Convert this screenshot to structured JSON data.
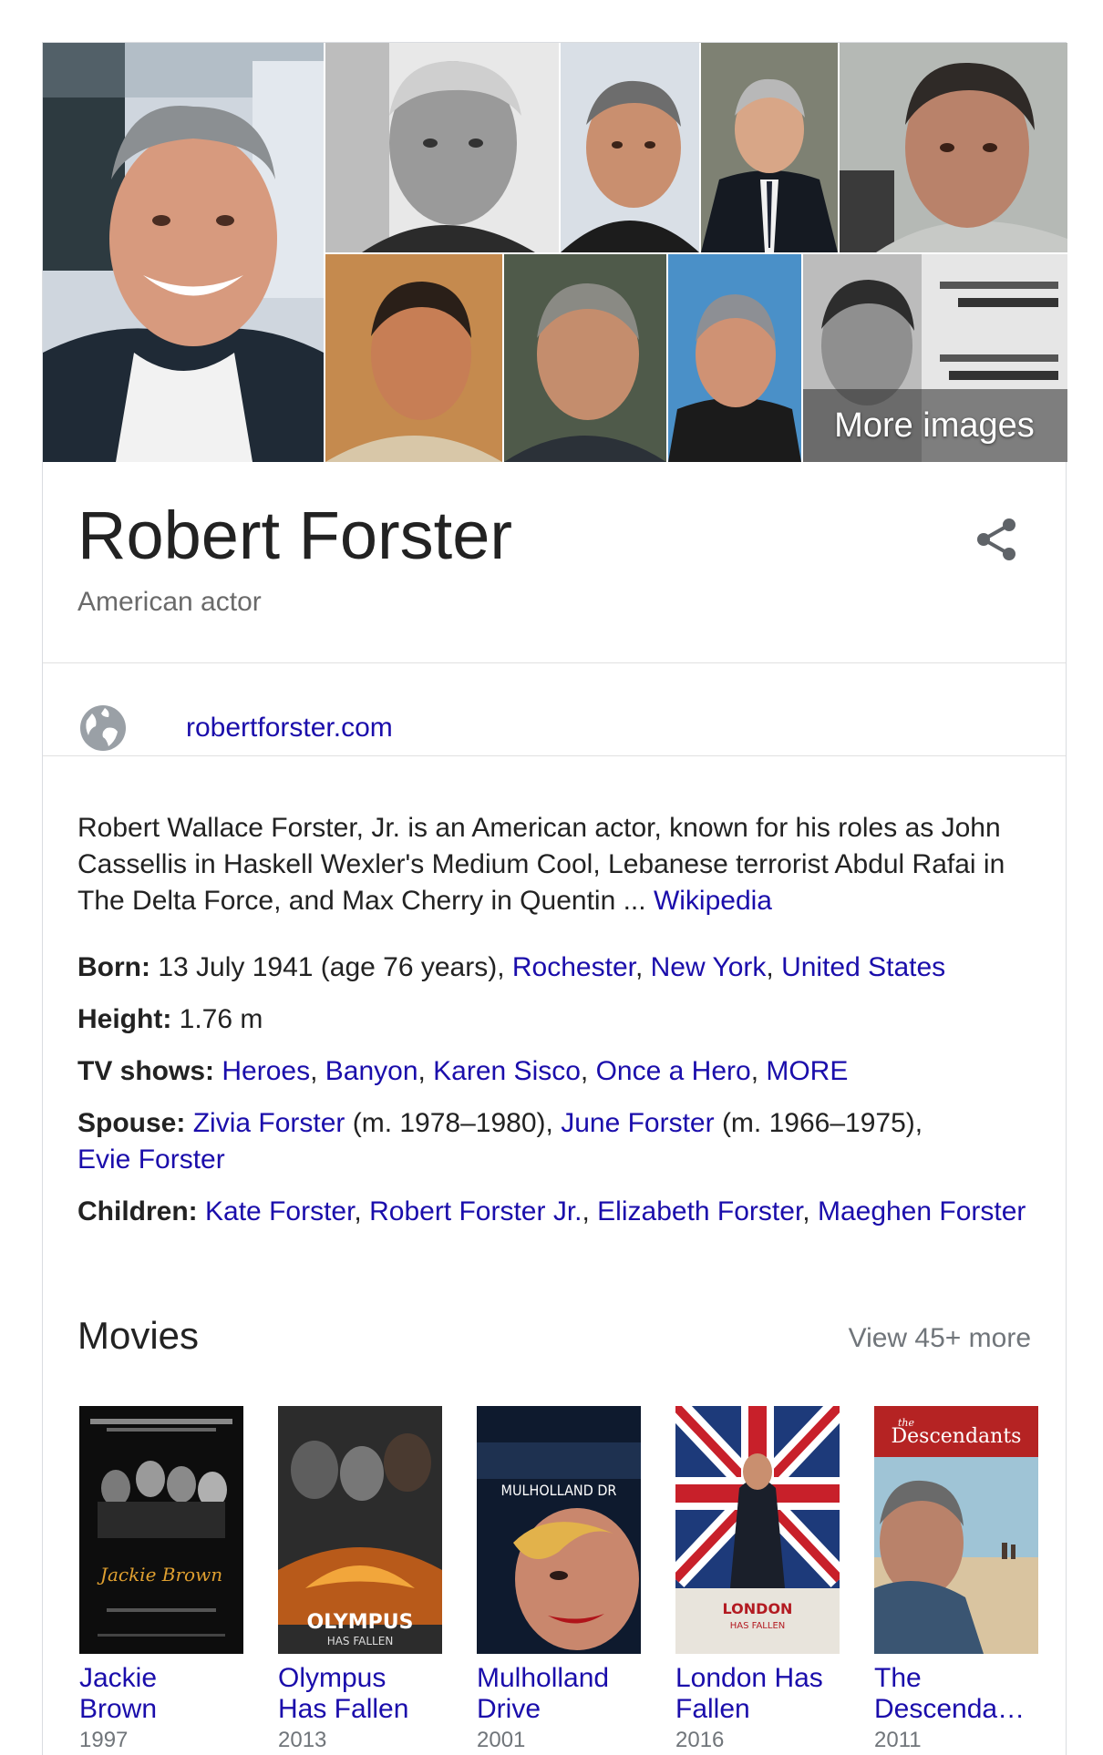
{
  "gallery": {
    "more_images_label": "More images"
  },
  "header": {
    "title": "Robert Forster",
    "subtitle": "American actor"
  },
  "website": {
    "url_text": "robertforster.com"
  },
  "description": {
    "text": "Robert Wallace Forster, Jr. is an American actor, known for his roles as John Cassellis in Haskell Wexler's Medium Cool, Lebanese terrorist Abdul Rafai in The Delta Force, and Max Cherry in Quentin ... ",
    "source_link": "Wikipedia"
  },
  "facts": {
    "born": {
      "label": "Born:",
      "text": " 13 July 1941 (age 76 years), ",
      "links": [
        "Rochester",
        "New York",
        "United States"
      ]
    },
    "height": {
      "label": "Height:",
      "text": " 1.76 m"
    },
    "tv_shows": {
      "label": "TV shows:",
      "links": [
        "Heroes",
        "Banyon",
        "Karen Sisco",
        "Once a Hero",
        "MORE"
      ]
    },
    "spouse": {
      "label": "Spouse:",
      "s1_name": "Zivia Forster",
      "s1_years": " (m. 1978–1980), ",
      "s2_name": "June Forster",
      "s2_years": " (m. 1966–1975),",
      "s3_name": "Evie Forster"
    },
    "children": {
      "label": "Children:",
      "links": [
        "Kate Forster",
        "Robert Forster Jr.",
        "Elizabeth Forster",
        "Maeghen Forster"
      ]
    }
  },
  "movies": {
    "heading": "Movies",
    "view_more": "View 45+ more",
    "items": [
      {
        "title_line1": "Jackie",
        "title_line2": "Brown",
        "year": "1997"
      },
      {
        "title_line1": "Olympus",
        "title_line2": "Has Fallen",
        "year": "2013"
      },
      {
        "title_line1": "Mulholland",
        "title_line2": "Drive",
        "year": "2001"
      },
      {
        "title_line1": "London Has",
        "title_line2": "Fallen",
        "year": "2016"
      },
      {
        "title_line1": "The",
        "title_line2": "Descenda…",
        "year": "2011"
      }
    ],
    "poster_texts": {
      "jackie": "Jackie Brown",
      "olympus": "OLYMPUS",
      "olympus_sub": "HAS FALLEN",
      "mulholland": "MULHOLLAND DR",
      "london": "LONDON",
      "london_sub": "HAS FALLEN",
      "descendants": "Descendants",
      "descendants_the": "the"
    }
  },
  "colors": {
    "link": "#1a0dab",
    "muted": "#70757a",
    "text": "#222222"
  }
}
